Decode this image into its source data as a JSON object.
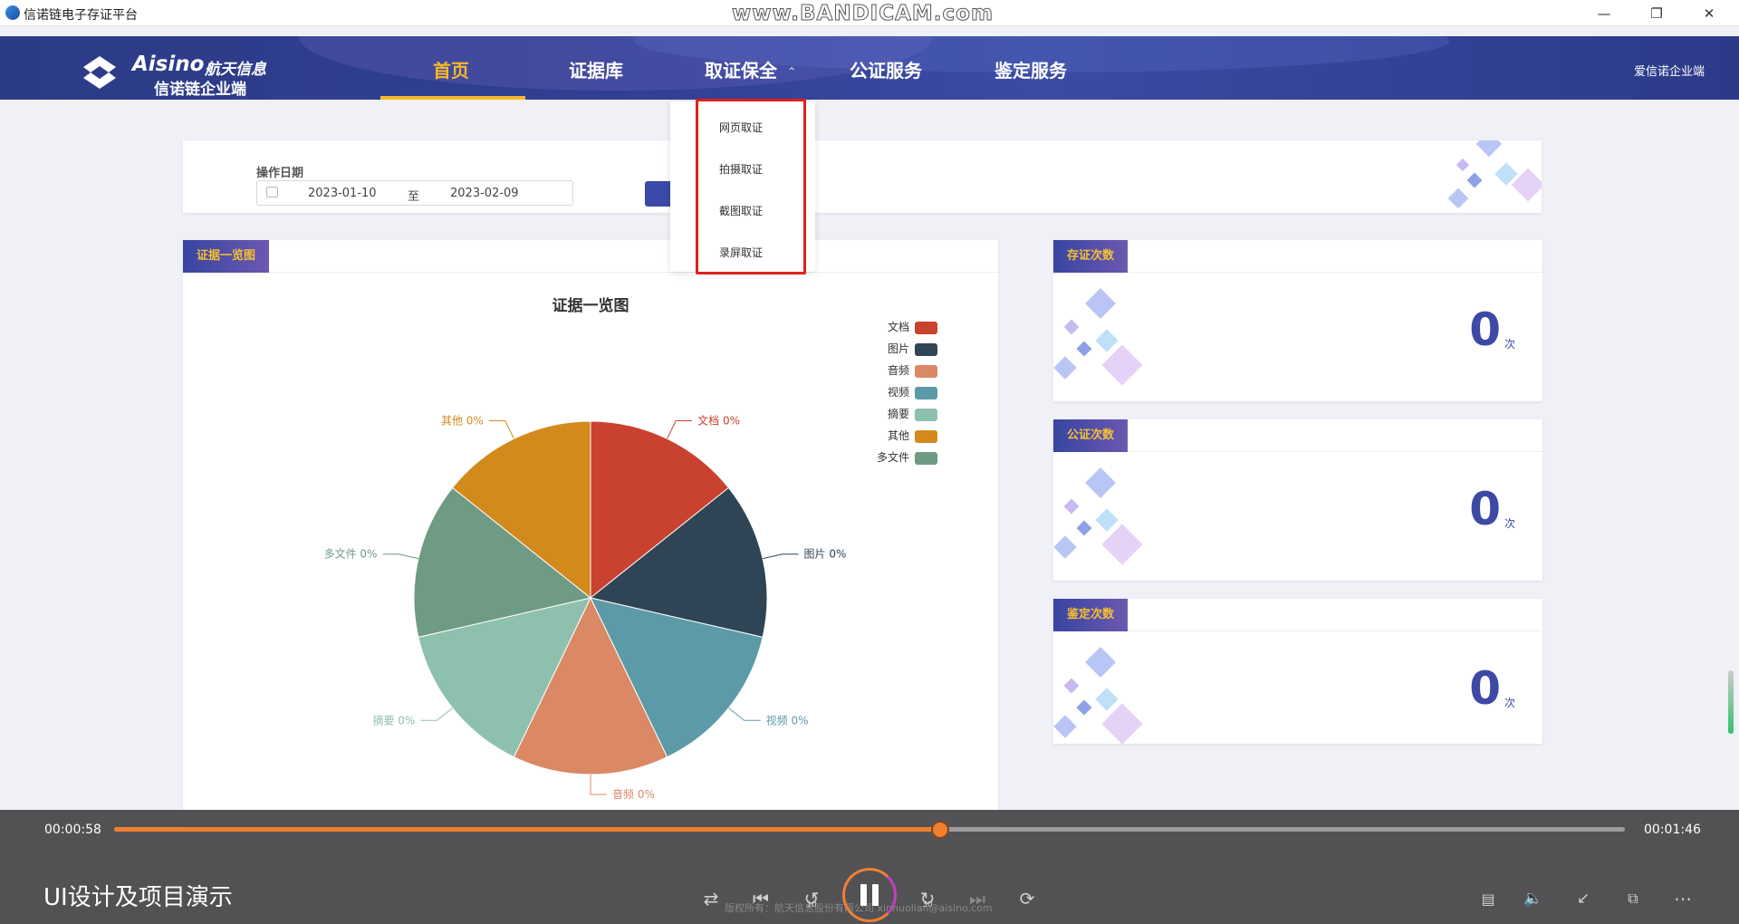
{
  "window": {
    "title": "信诺链电子存证平台",
    "watermark": "www.BANDICAM.com"
  },
  "nav": {
    "brand": "Aisino",
    "brand_cn": "航天信息",
    "subtitle": "信诺链企业端",
    "items": [
      {
        "label": "首页",
        "active": true
      },
      {
        "label": "证据库"
      },
      {
        "label": "取证保全"
      },
      {
        "label": "公证服务"
      },
      {
        "label": "鉴定服务"
      }
    ],
    "user": "爱信诺企业端"
  },
  "dropdown": {
    "items": [
      "网页取证",
      "拍摄取证",
      "截图取证",
      "录屏取证"
    ]
  },
  "filter": {
    "label": "操作日期",
    "start": "2023-01-10",
    "sep": "至",
    "end": "2023-02-09"
  },
  "overview": {
    "tag": "证据一览图"
  },
  "chart_data": {
    "type": "pie",
    "title": "证据一览图",
    "categories": [
      "文档",
      "图片",
      "视频",
      "音频",
      "摘要",
      "多文件",
      "其他"
    ],
    "values": [
      0,
      0,
      0,
      0,
      0,
      0,
      0
    ],
    "labels": [
      "文档  0%",
      "图片  0%",
      "视频  0%",
      "音频  0%",
      "摘要  0%",
      "多文件  0%",
      "其他  0%"
    ],
    "colors": [
      "#c9412f",
      "#2f4556",
      "#5d9aa8",
      "#db8865",
      "#8ec1ad",
      "#6f9a83",
      "#d28a1d"
    ],
    "legend": [
      "文档",
      "图片",
      "音频",
      "视频",
      "摘要",
      "其他",
      "多文件"
    ],
    "legend_colors": [
      "#c9412f",
      "#2f4556",
      "#db8865",
      "#5d9aa8",
      "#8ec1ad",
      "#d28a1d",
      "#6f9a83"
    ],
    "legend_position": "top-right"
  },
  "stats": [
    {
      "tag": "存证次数",
      "value": "0",
      "unit": "次"
    },
    {
      "tag": "公证次数",
      "value": "0",
      "unit": "次"
    },
    {
      "tag": "鉴定次数",
      "value": "0",
      "unit": "次"
    }
  ],
  "player": {
    "current": "00:00:58",
    "total": "00:01:46",
    "progress": 0.547,
    "title": "UI设计及项目演示",
    "skip_back": "10",
    "skip_fwd": "30",
    "copyright": "版权所有：航天信息股份有限公司  xinnuolian@aisino.com"
  }
}
